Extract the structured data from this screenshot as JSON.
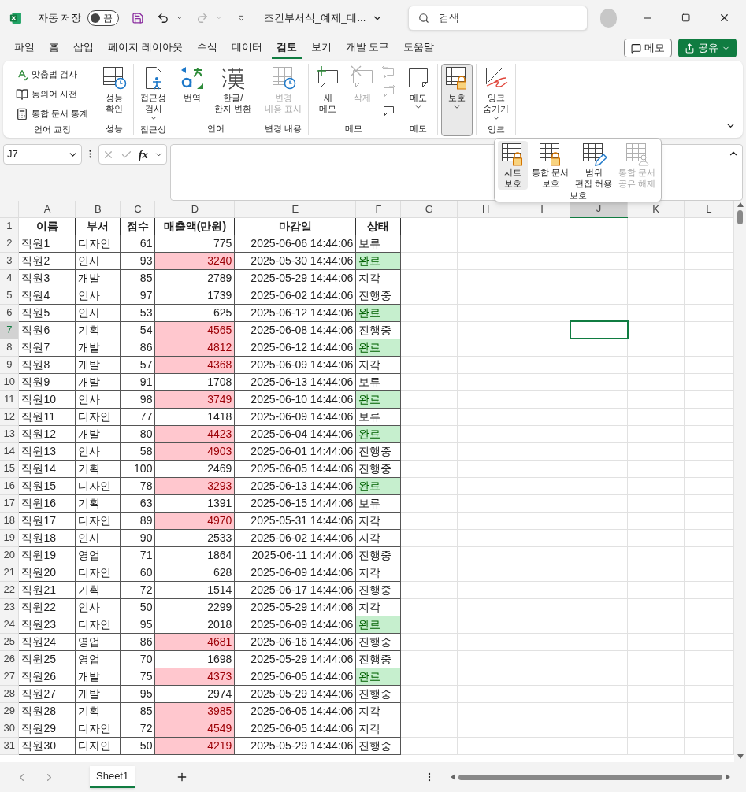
{
  "title_bar": {
    "autosave_label": "자동 저장",
    "autosave": {
      "on": false,
      "text": "끔"
    },
    "redo_disabled": true,
    "document_title": "조건부서식_예제_데...",
    "search": {
      "placeholder": "검색"
    }
  },
  "menu_tabs": [
    {
      "label": "파일",
      "selected": false
    },
    {
      "label": "홈",
      "selected": false
    },
    {
      "label": "삽입",
      "selected": false
    },
    {
      "label": "페이지 레이아웃",
      "selected": false
    },
    {
      "label": "수식",
      "selected": false
    },
    {
      "label": "데이터",
      "selected": false
    },
    {
      "label": "검토",
      "selected": true
    },
    {
      "label": "보기",
      "selected": false
    },
    {
      "label": "개발 도구",
      "selected": false
    },
    {
      "label": "도움말",
      "selected": false
    }
  ],
  "comments_button": "메모",
  "share_button": "공유",
  "ribbon": {
    "groups": [
      {
        "label": "언어 교정",
        "items": [
          {
            "kind": "small",
            "label": "맞춤법 검사",
            "disabled": false,
            "pressed": false
          },
          {
            "kind": "small",
            "label": "동의어 사전",
            "disabled": false,
            "pressed": false
          },
          {
            "kind": "small",
            "label": "통합 문서 통계",
            "disabled": false,
            "pressed": false
          }
        ]
      },
      {
        "label": "성능",
        "items": [
          {
            "kind": "large",
            "label": "성능\n확인",
            "disabled": false,
            "dropdown": false,
            "pressed": false
          }
        ]
      },
      {
        "label": "접근성",
        "items": [
          {
            "kind": "large",
            "label": "접근성\n검사",
            "disabled": false,
            "dropdown": true,
            "pressed": false
          }
        ]
      },
      {
        "label": "언어",
        "items": [
          {
            "kind": "large",
            "label": "번역",
            "disabled": false,
            "dropdown": false,
            "pressed": false
          },
          {
            "kind": "large",
            "label": "한글/\n한자 변환",
            "disabled": false,
            "dropdown": false,
            "pressed": false
          }
        ]
      },
      {
        "label": "변경 내용",
        "items": [
          {
            "kind": "large",
            "label": "변경\n내용 표시",
            "disabled": true,
            "dropdown": false,
            "pressed": false
          }
        ]
      },
      {
        "label": "메모",
        "items": [
          {
            "kind": "large",
            "label": "새\n메모",
            "disabled": false,
            "dropdown": false,
            "pressed": false
          },
          {
            "kind": "large",
            "label": "삭제",
            "disabled": true,
            "dropdown": false,
            "pressed": false
          },
          {
            "kind": "icons",
            "icons": [
              {
                "disabled": true
              },
              {
                "disabled": true
              },
              {
                "disabled": false
              }
            ]
          }
        ]
      },
      {
        "label": "메모",
        "items": [
          {
            "kind": "large",
            "label": "메모",
            "disabled": false,
            "dropdown": true,
            "pressed": false
          }
        ]
      },
      {
        "items": [
          {
            "kind": "large",
            "label": "보호",
            "disabled": false,
            "dropdown": true,
            "pressed": true
          }
        ]
      },
      {
        "label": "잉크",
        "items": [
          {
            "kind": "large",
            "label": "잉크\n숨기기",
            "disabled": false,
            "dropdown": true,
            "pressed": false
          }
        ]
      }
    ]
  },
  "protect_menu": {
    "label": "보호",
    "items": [
      {
        "label": "시트\n보호",
        "disabled": false,
        "hovered": true
      },
      {
        "label": "통합 문서\n보호",
        "disabled": false,
        "hovered": false
      },
      {
        "label": "범위\n편집 허용",
        "disabled": false,
        "hovered": false
      },
      {
        "label": "통합 문서\n공유 해제",
        "disabled": true,
        "hovered": false
      }
    ]
  },
  "formula_bar": {
    "name_box": "J7",
    "function_label": "fx"
  },
  "sheet": {
    "columns": [
      {
        "label": "A",
        "selected": false
      },
      {
        "label": "B",
        "selected": false
      },
      {
        "label": "C",
        "selected": false
      },
      {
        "label": "D",
        "selected": false
      },
      {
        "label": "E",
        "selected": false
      },
      {
        "label": "F",
        "selected": false
      },
      {
        "label": "G",
        "selected": false
      },
      {
        "label": "H",
        "selected": false
      },
      {
        "label": "I",
        "selected": false
      },
      {
        "label": "J",
        "selected": true
      },
      {
        "label": "K",
        "selected": false
      },
      {
        "label": "L",
        "selected": false
      }
    ],
    "header_row": {
      "number": "1",
      "cells": [
        "이름",
        "부서",
        "점수",
        "매출액(만원)",
        "마감일",
        "상태"
      ]
    },
    "rows": [
      {
        "number": "2",
        "selected": false,
        "cells": [
          "직원1",
          "디자인",
          "61",
          "775",
          "2025-06-06 14:44:06",
          "보류"
        ],
        "sales_highlight": false,
        "status_highlight": false
      },
      {
        "number": "3",
        "selected": false,
        "cells": [
          "직원2",
          "인사",
          "93",
          "3240",
          "2025-05-30 14:44:06",
          "완료"
        ],
        "sales_highlight": true,
        "status_highlight": true
      },
      {
        "number": "4",
        "selected": false,
        "cells": [
          "직원3",
          "개발",
          "85",
          "2789",
          "2025-05-29 14:44:06",
          "지각"
        ],
        "sales_highlight": false,
        "status_highlight": false
      },
      {
        "number": "5",
        "selected": false,
        "cells": [
          "직원4",
          "인사",
          "97",
          "1739",
          "2025-06-02 14:44:06",
          "진행중"
        ],
        "sales_highlight": false,
        "status_highlight": false
      },
      {
        "number": "6",
        "selected": false,
        "cells": [
          "직원5",
          "인사",
          "53",
          "625",
          "2025-06-12 14:44:06",
          "완료"
        ],
        "sales_highlight": false,
        "status_highlight": true
      },
      {
        "number": "7",
        "selected": true,
        "cells": [
          "직원6",
          "기획",
          "54",
          "4565",
          "2025-06-08 14:44:06",
          "진행중"
        ],
        "sales_highlight": true,
        "status_highlight": false
      },
      {
        "number": "8",
        "selected": false,
        "cells": [
          "직원7",
          "개발",
          "86",
          "4812",
          "2025-06-12 14:44:06",
          "완료"
        ],
        "sales_highlight": true,
        "status_highlight": true
      },
      {
        "number": "9",
        "selected": false,
        "cells": [
          "직원8",
          "개발",
          "57",
          "4368",
          "2025-06-09 14:44:06",
          "지각"
        ],
        "sales_highlight": true,
        "status_highlight": false
      },
      {
        "number": "10",
        "selected": false,
        "cells": [
          "직원9",
          "개발",
          "91",
          "1708",
          "2025-06-13 14:44:06",
          "보류"
        ],
        "sales_highlight": false,
        "status_highlight": false
      },
      {
        "number": "11",
        "selected": false,
        "cells": [
          "직원10",
          "인사",
          "98",
          "3749",
          "2025-06-10 14:44:06",
          "완료"
        ],
        "sales_highlight": true,
        "status_highlight": true
      },
      {
        "number": "12",
        "selected": false,
        "cells": [
          "직원11",
          "디자인",
          "77",
          "1418",
          "2025-06-09 14:44:06",
          "보류"
        ],
        "sales_highlight": false,
        "status_highlight": false
      },
      {
        "number": "13",
        "selected": false,
        "cells": [
          "직원12",
          "개발",
          "80",
          "4423",
          "2025-06-04 14:44:06",
          "완료"
        ],
        "sales_highlight": true,
        "status_highlight": true
      },
      {
        "number": "14",
        "selected": false,
        "cells": [
          "직원13",
          "인사",
          "58",
          "4903",
          "2025-06-01 14:44:06",
          "진행중"
        ],
        "sales_highlight": true,
        "status_highlight": false
      },
      {
        "number": "15",
        "selected": false,
        "cells": [
          "직원14",
          "기획",
          "100",
          "2469",
          "2025-06-05 14:44:06",
          "진행중"
        ],
        "sales_highlight": false,
        "status_highlight": false
      },
      {
        "number": "16",
        "selected": false,
        "cells": [
          "직원15",
          "디자인",
          "78",
          "3293",
          "2025-06-13 14:44:06",
          "완료"
        ],
        "sales_highlight": true,
        "status_highlight": true
      },
      {
        "number": "17",
        "selected": false,
        "cells": [
          "직원16",
          "기획",
          "63",
          "1391",
          "2025-06-15 14:44:06",
          "보류"
        ],
        "sales_highlight": false,
        "status_highlight": false
      },
      {
        "number": "18",
        "selected": false,
        "cells": [
          "직원17",
          "디자인",
          "89",
          "4970",
          "2025-05-31 14:44:06",
          "지각"
        ],
        "sales_highlight": true,
        "status_highlight": false
      },
      {
        "number": "19",
        "selected": false,
        "cells": [
          "직원18",
          "인사",
          "90",
          "2533",
          "2025-06-02 14:44:06",
          "지각"
        ],
        "sales_highlight": false,
        "status_highlight": false
      },
      {
        "number": "20",
        "selected": false,
        "cells": [
          "직원19",
          "영업",
          "71",
          "1864",
          "2025-06-11 14:44:06",
          "진행중"
        ],
        "sales_highlight": false,
        "status_highlight": false
      },
      {
        "number": "21",
        "selected": false,
        "cells": [
          "직원20",
          "디자인",
          "60",
          "628",
          "2025-06-09 14:44:06",
          "지각"
        ],
        "sales_highlight": false,
        "status_highlight": false
      },
      {
        "number": "22",
        "selected": false,
        "cells": [
          "직원21",
          "기획",
          "72",
          "1514",
          "2025-06-17 14:44:06",
          "진행중"
        ],
        "sales_highlight": false,
        "status_highlight": false
      },
      {
        "number": "23",
        "selected": false,
        "cells": [
          "직원22",
          "인사",
          "50",
          "2299",
          "2025-05-29 14:44:06",
          "지각"
        ],
        "sales_highlight": false,
        "status_highlight": false
      },
      {
        "number": "24",
        "selected": false,
        "cells": [
          "직원23",
          "디자인",
          "95",
          "2018",
          "2025-06-09 14:44:06",
          "완료"
        ],
        "sales_highlight": false,
        "status_highlight": true
      },
      {
        "number": "25",
        "selected": false,
        "cells": [
          "직원24",
          "영업",
          "86",
          "4681",
          "2025-06-16 14:44:06",
          "진행중"
        ],
        "sales_highlight": true,
        "status_highlight": false
      },
      {
        "number": "26",
        "selected": false,
        "cells": [
          "직원25",
          "영업",
          "70",
          "1698",
          "2025-05-29 14:44:06",
          "진행중"
        ],
        "sales_highlight": false,
        "status_highlight": false
      },
      {
        "number": "27",
        "selected": false,
        "cells": [
          "직원26",
          "개발",
          "75",
          "4373",
          "2025-06-05 14:44:06",
          "완료"
        ],
        "sales_highlight": true,
        "status_highlight": true
      },
      {
        "number": "28",
        "selected": false,
        "cells": [
          "직원27",
          "개발",
          "95",
          "2974",
          "2025-05-29 14:44:06",
          "진행중"
        ],
        "sales_highlight": false,
        "status_highlight": false
      },
      {
        "number": "29",
        "selected": false,
        "cells": [
          "직원28",
          "기획",
          "85",
          "3985",
          "2025-06-05 14:44:06",
          "지각"
        ],
        "sales_highlight": true,
        "status_highlight": false
      },
      {
        "number": "30",
        "selected": false,
        "cells": [
          "직원29",
          "디자인",
          "72",
          "4549",
          "2025-06-05 14:44:06",
          "지각"
        ],
        "sales_highlight": true,
        "status_highlight": false
      },
      {
        "number": "31",
        "selected": false,
        "cells": [
          "직원30",
          "디자인",
          "50",
          "4219",
          "2025-05-29 14:44:06",
          "진행중"
        ],
        "sales_highlight": true,
        "status_highlight": false
      }
    ]
  },
  "sheet_tabs": [
    {
      "label": "Sheet1",
      "selected": true
    }
  ]
}
